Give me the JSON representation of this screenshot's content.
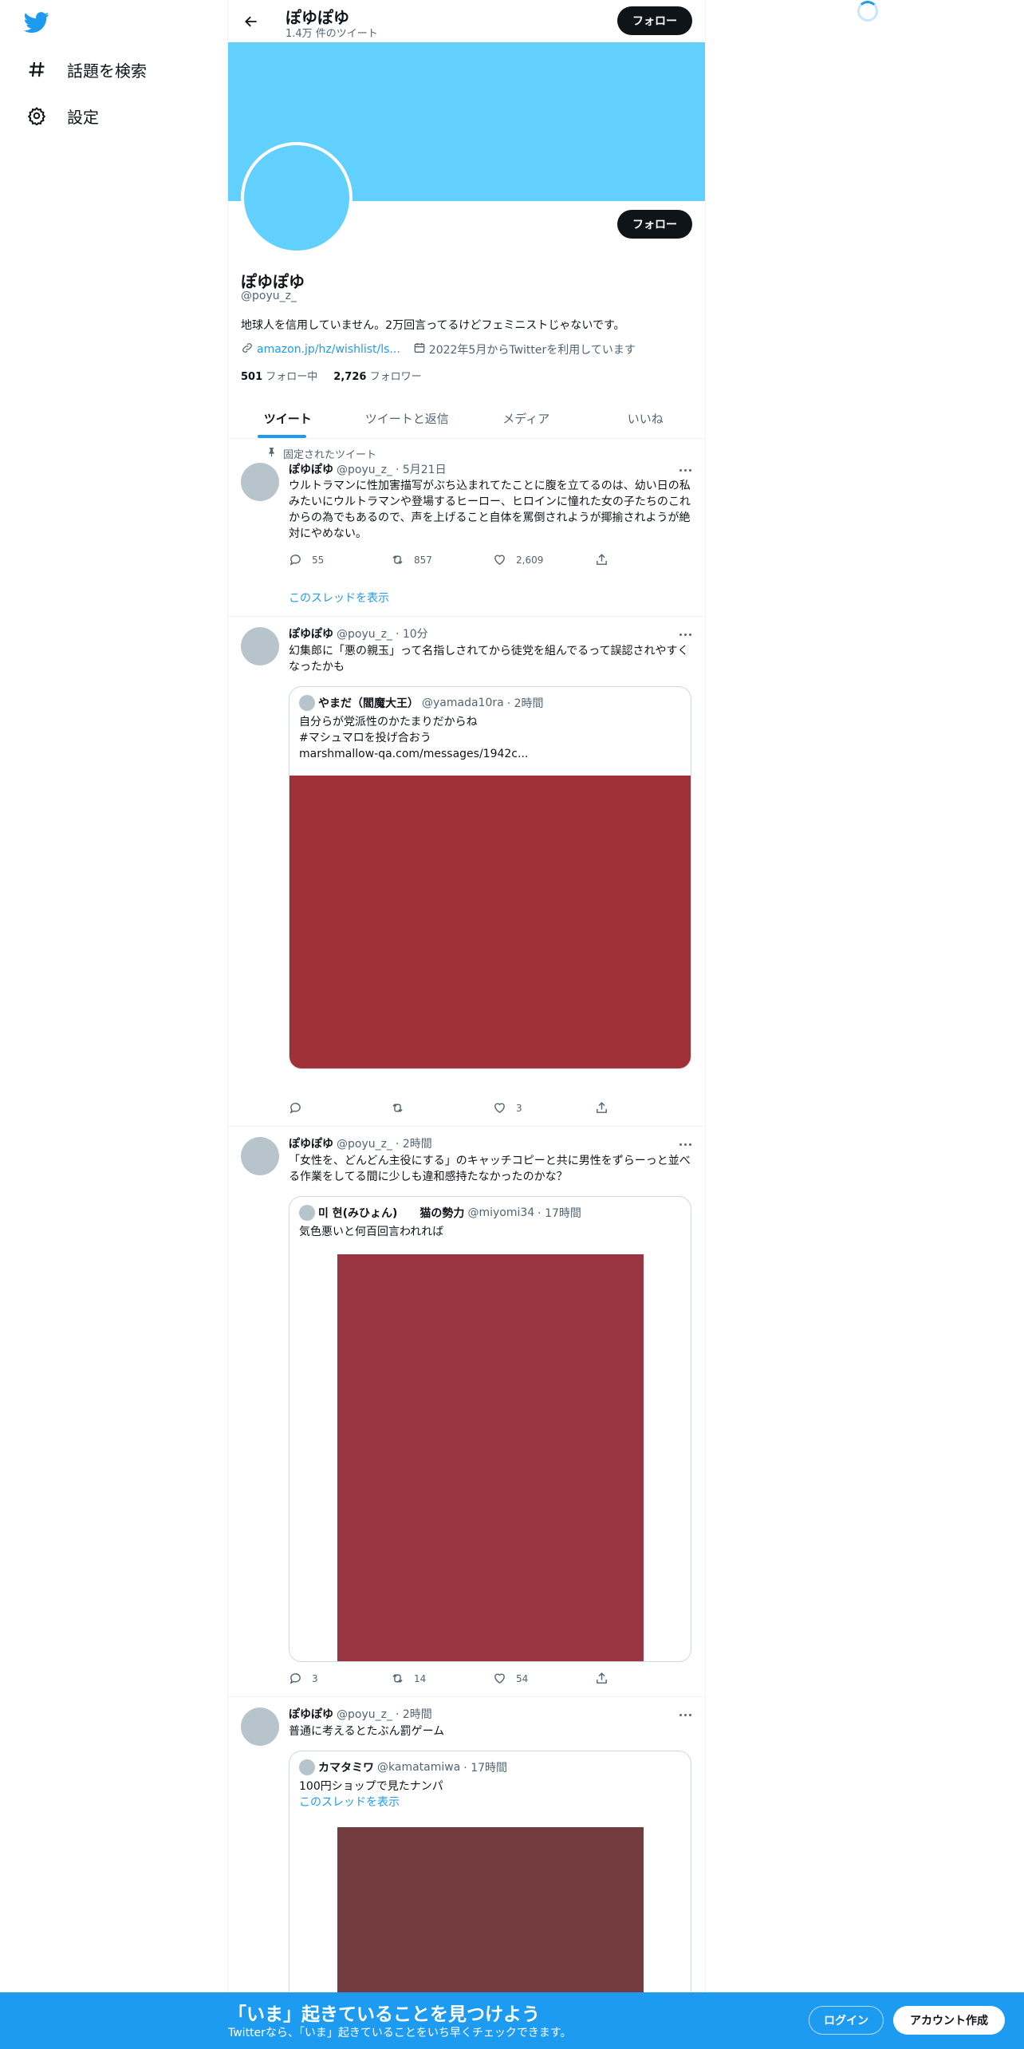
{
  "nav": {
    "logo_icon": "twitter-bird-icon",
    "explore_label": "話題を検索",
    "settings_label": "設定"
  },
  "header": {
    "name": "ぽゆぽゆ",
    "tweet_count": "1.4万 件のツイート",
    "follow_label": "フォロー"
  },
  "profile": {
    "follow_label": "フォロー",
    "name": "ぽゆぽゆ",
    "handle": "@poyu_z_",
    "bio": "地球人を信用していません。2万回言ってるけどフェミニストじゃないです。",
    "link": "amazon.jp/hz/wishlist/ls...",
    "joined": "2022年5月からTwitterを利用しています",
    "following_count": "501",
    "following_label": "フォロー中",
    "followers_count": "2,726",
    "followers_label": "フォロワー",
    "banner_color": "#62d0fd"
  },
  "tabs": [
    "ツイート",
    "ツイートと返信",
    "メディア",
    "いいね"
  ],
  "tweets": [
    {
      "pinned_label": "固定されたツイート",
      "name": "ぽゆぽゆ",
      "handle": "@poyu_z_",
      "time": "· 5月21日",
      "text": "ウルトラマンに性加害描写がぶち込まれてたことに腹を立てるのは、幼い日の私みたいにウルトラマンや登場するヒーロー、ヒロインに憧れた女の子たちのこれからの為でもあるので、声を上げること自体を罵倒されようが揶揄されようが絶対にやめない。",
      "replies": "55",
      "retweets": "857",
      "likes": "2,609",
      "show_thread": "このスレッドを表示"
    },
    {
      "name": "ぽゆぽゆ",
      "handle": "@poyu_z_",
      "time": "· 10分",
      "text": "幻集郎に「悪の親玉」って名指しされてから徒党を組んでるって誤認されやすくなったかも",
      "quote": {
        "name": "やまだ（閻魔大王）",
        "handle": "@yamada10ra",
        "time": "· 2時間",
        "line1": "自分らが党派性のかたまりだからね",
        "line2": "#マシュマロを投げ合おう",
        "line3": "marshmallow-qa.com/messages/1942c...",
        "image_color": "#a23039"
      },
      "replies": "",
      "retweets": "",
      "likes": "3"
    },
    {
      "name": "ぽゆぽゆ",
      "handle": "@poyu_z_",
      "time": "· 2時間",
      "text": "「女性を、どんどん主役にする」のキャッチコピーと共に男性をずらーっと並べる作業をしてる間に少しも違和感持たなかったのかな？",
      "quote": {
        "name": "미 현(みひょん)　　猫の勢力",
        "handle": "@miyomi34",
        "time": "· 17時間",
        "line1": "気色悪いと何百回言われれば",
        "image_color": "#983541"
      },
      "replies": "3",
      "retweets": "14",
      "likes": "54"
    },
    {
      "name": "ぽゆぽゆ",
      "handle": "@poyu_z_",
      "time": "· 2時間",
      "text": "普通に考えるとたぶん罰ゲーム",
      "quote": {
        "name": "カマタミワ",
        "handle": "@kamatamiwa",
        "time": "· 17時間",
        "line1": "100円ショップで見たナンパ",
        "show_thread": "このスレッドを表示",
        "image_color": "#733d3f"
      }
    }
  ],
  "bottom_bar": {
    "title": "「いま」起きていることを見つけよう",
    "subtitle": "Twitterなら、「いま」起きていることをいち早くチェックできます。",
    "login_label": "ログイン",
    "signup_label": "アカウント作成"
  }
}
